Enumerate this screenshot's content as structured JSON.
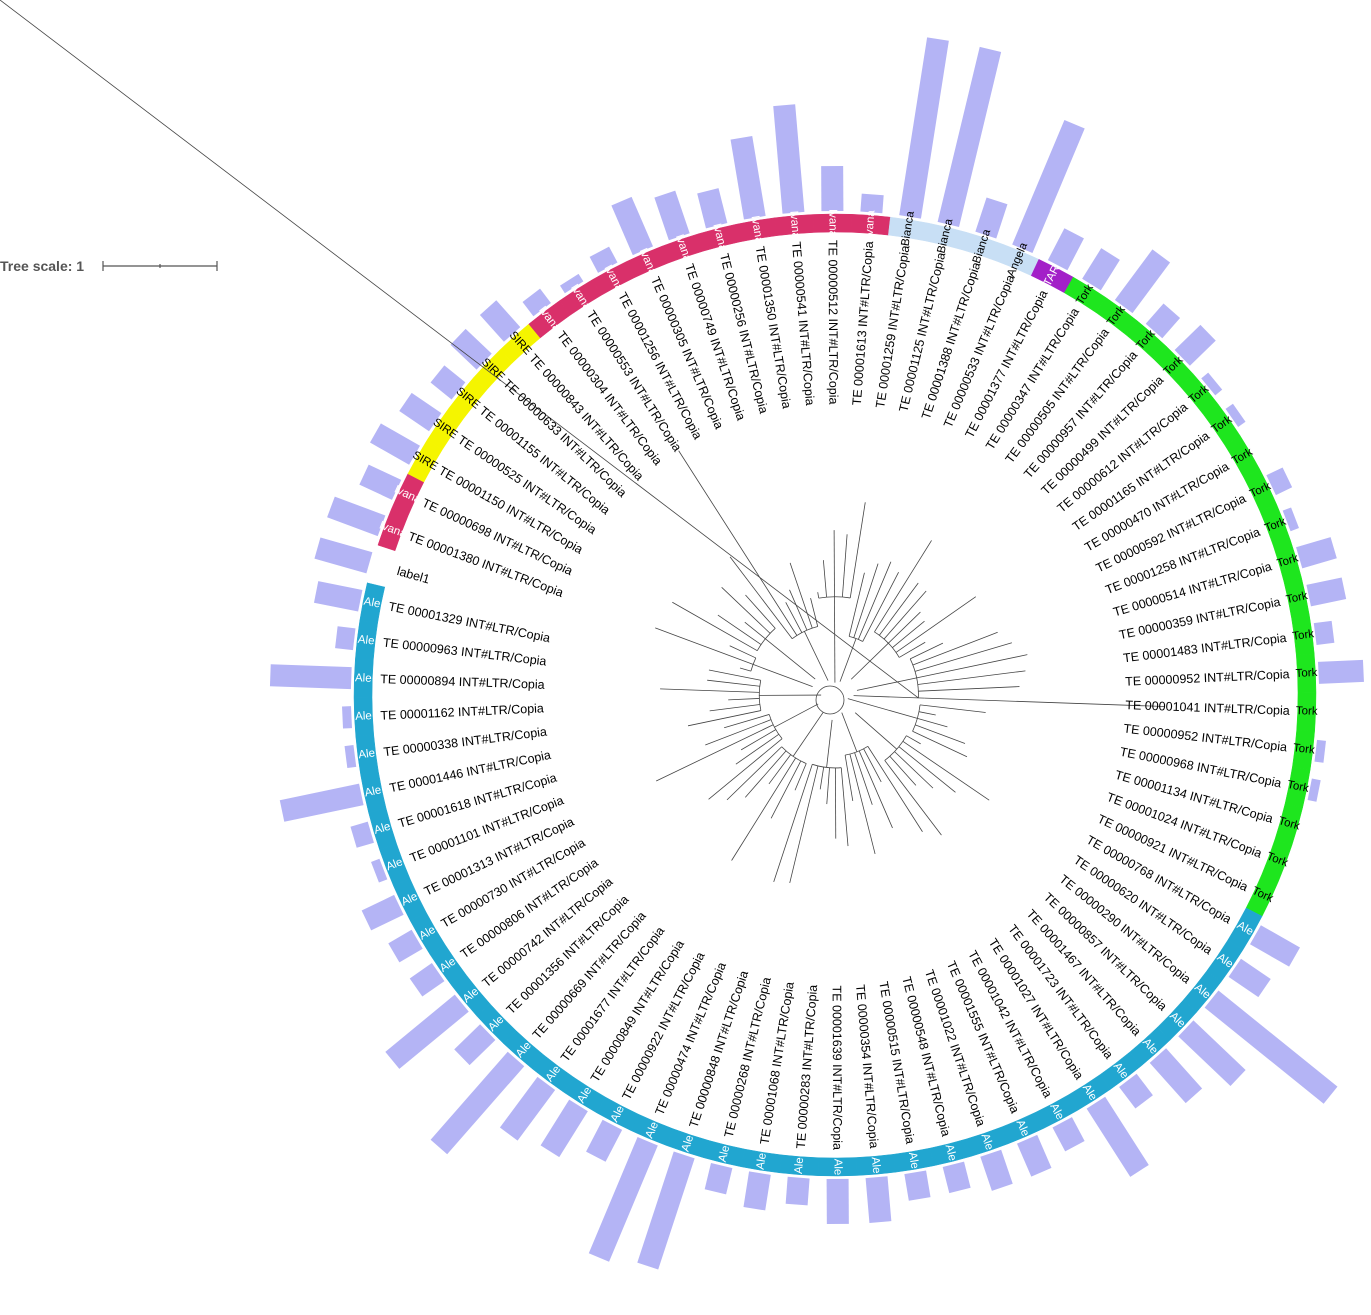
{
  "scale": {
    "label": "Tree scale: 1"
  },
  "colors": {
    "Ale": "#21a6d0",
    "Tork": "#1ee61e",
    "TAR": "#a320c8",
    "Angela": "#c8dff5",
    "Bianca": "#c8dff5",
    "Ivana": "#d9306a",
    "SIRE": "#f5f500",
    "label1": "#ffffff",
    "bars": "#b4b4f5"
  },
  "leaves": [
    {
      "label": "TE 00001041 INT#LTR/Copia",
      "clade": "Tork",
      "bar": 0.0
    },
    {
      "label": "TE 00000952 INT#LTR/Copia",
      "clade": "Tork",
      "bar": 0.1
    },
    {
      "label": "TE 00000968 INT#LTR/Copia",
      "clade": "Tork",
      "bar": 0.1
    },
    {
      "label": "TE 00001134 INT#LTR/Copia",
      "clade": "Tork",
      "bar": 0.0
    },
    {
      "label": "TE 00001024 INT#LTR/Copia",
      "clade": "Tork",
      "bar": 0.0
    },
    {
      "label": "TE 00000921 INT#LTR/Copia",
      "clade": "Tork",
      "bar": 0.0
    },
    {
      "label": "TE 00000768 INT#LTR/Copia",
      "clade": "Ale",
      "bar": 0.5
    },
    {
      "label": "TE 00000620 INT#LTR/Copia",
      "clade": "Ale",
      "bar": 0.4
    },
    {
      "label": "TE 00000290 INT#LTR/Copia",
      "clade": "Ale",
      "bar": 1.7
    },
    {
      "label": "TE 00000857 INT#LTR/Copia",
      "clade": "Ale",
      "bar": 0.8
    },
    {
      "label": "TE 00001467 INT#LTR/Copia",
      "clade": "Ale",
      "bar": 0.6
    },
    {
      "label": "TE 00001723 INT#LTR/Copia",
      "clade": "Ale",
      "bar": 0.3
    },
    {
      "label": "TE 00001027 INT#LTR/Copia",
      "clade": "Ale",
      "bar": 0.9
    },
    {
      "label": "TE 00001042 INT#LTR/Copia",
      "clade": "Ale",
      "bar": 0.3
    },
    {
      "label": "TE 00001555 INT#LTR/Copia",
      "clade": "Ale",
      "bar": 0.4
    },
    {
      "label": "TE 00001022 INT#LTR/Copia",
      "clade": "Ale",
      "bar": 0.4
    },
    {
      "label": "TE 00000548 INT#LTR/Copia",
      "clade": "Ale",
      "bar": 0.3
    },
    {
      "label": "TE 00000515 INT#LTR/Copia",
      "clade": "Ale",
      "bar": 0.3
    },
    {
      "label": "TE 00000354 INT#LTR/Copia",
      "clade": "Ale",
      "bar": 0.5
    },
    {
      "label": "TE 00001639 INT#LTR/Copia",
      "clade": "Ale",
      "bar": 0.5
    },
    {
      "label": "TE 00000283 INT#LTR/Copia",
      "clade": "Ale",
      "bar": 0.3
    },
    {
      "label": "TE 00001068 INT#LTR/Copia",
      "clade": "Ale",
      "bar": 0.4
    },
    {
      "label": "TE 00000268 INT#LTR/Copia",
      "clade": "Ale",
      "bar": 0.3
    },
    {
      "label": "TE 00000848 INT#LTR/Copia",
      "clade": "Ale",
      "bar": 1.3
    },
    {
      "label": "TE 00000474 INT#LTR/Copia",
      "clade": "Ale",
      "bar": 1.4
    },
    {
      "label": "TE 00000922 INT#LTR/Copia",
      "clade": "Ale",
      "bar": 0.4
    },
    {
      "label": "TE 00000849 INT#LTR/Copia",
      "clade": "Ale",
      "bar": 0.6
    },
    {
      "label": "TE 00001677 INT#LTR/Copia",
      "clade": "Ale",
      "bar": 0.7
    },
    {
      "label": "TE 00000669 INT#LTR/Copia",
      "clade": "Ale",
      "bar": 1.3
    },
    {
      "label": "TE 00001356 INT#LTR/Copia",
      "clade": "Ale",
      "bar": 0.4
    },
    {
      "label": "TE 00000742 INT#LTR/Copia",
      "clade": "Ale",
      "bar": 1.0
    },
    {
      "label": "TE 00000806 INT#LTR/Copia",
      "clade": "Ale",
      "bar": 0.3
    },
    {
      "label": "TE 00000730 INT#LTR/Copia",
      "clade": "Ale",
      "bar": 0.3
    },
    {
      "label": "TE 00001313 INT#LTR/Copia",
      "clade": "Ale",
      "bar": 0.4
    },
    {
      "label": "TE 00001101 INT#LTR/Copia",
      "clade": "Ale",
      "bar": 0.1
    },
    {
      "label": "TE 00001618 INT#LTR/Copia",
      "clade": "Ale",
      "bar": 0.2
    },
    {
      "label": "TE 00001446 INT#LTR/Copia",
      "clade": "Ale",
      "bar": 0.9
    },
    {
      "label": "TE 00000338 INT#LTR/Copia",
      "clade": "Ale",
      "bar": 0.1
    },
    {
      "label": "TE 00001162 INT#LTR/Copia",
      "clade": "Ale",
      "bar": 0.1
    },
    {
      "label": "TE 00000894 INT#LTR/Copia",
      "clade": "Ale",
      "bar": 0.9
    },
    {
      "label": "TE 00000963 INT#LTR/Copia",
      "clade": "Ale",
      "bar": 0.2
    },
    {
      "label": "TE 00001329 INT#LTR/Copia",
      "clade": "Ale",
      "bar": 0.5
    },
    {
      "label": "label1",
      "clade": "label1",
      "bar": 0.6
    },
    {
      "label": "TE 00001380 INT#LTR/Copia",
      "clade": "Ivana",
      "bar": 0.6
    },
    {
      "label": "TE 00000698 INT#LTR/Copia",
      "clade": "Ivana",
      "bar": 0.4
    },
    {
      "label": "TE 00001150 INT#LTR/Copia",
      "clade": "SIRE",
      "bar": 0.5
    },
    {
      "label": "TE 00000525 INT#LTR/Copia",
      "clade": "SIRE",
      "bar": 0.4
    },
    {
      "label": "TE 00001155 INT#LTR/Copia",
      "clade": "SIRE",
      "bar": 0.3
    },
    {
      "label": "TE 00000633 INT#LTR/Copia",
      "clade": "SIRE",
      "bar": 0.4
    },
    {
      "label": "TE 00000843 INT#LTR/Copia",
      "clade": "SIRE",
      "bar": 0.4
    },
    {
      "label": "TE 00000304 INT#LTR/Copia",
      "clade": "Ivana",
      "bar": 0.2
    },
    {
      "label": "TE 00000553 INT#LTR/Copia",
      "clade": "Ivana",
      "bar": 0.1
    },
    {
      "label": "TE 00001256 INT#LTR/Copia",
      "clade": "Ivana",
      "bar": 0.2
    },
    {
      "label": "TE 00000305 INT#LTR/Copia",
      "clade": "Ivana",
      "bar": 0.6
    },
    {
      "label": "TE 00000749 INT#LTR/Copia",
      "clade": "Ivana",
      "bar": 0.5
    },
    {
      "label": "TE 00000256 INT#LTR/Copia",
      "clade": "Ivana",
      "bar": 0.4
    },
    {
      "label": "TE 00001350 INT#LTR/Copia",
      "clade": "Ivana",
      "bar": 0.9
    },
    {
      "label": "TE 00000541 INT#LTR/Copia",
      "clade": "Ivana",
      "bar": 1.2
    },
    {
      "label": "TE 00000512 INT#LTR/Copia",
      "clade": "Ivana",
      "bar": 0.5
    },
    {
      "label": "TE 00001613 INT#LTR/Copia",
      "clade": "Ivana",
      "bar": 0.2
    },
    {
      "label": "TE 00001259 INT#LTR/Copia",
      "clade": "Bianca",
      "bar": 2.0
    },
    {
      "label": "TE 00001125 INT#LTR/Copia",
      "clade": "Bianca",
      "bar": 2.0
    },
    {
      "label": "TE 00001388 INT#LTR/Copia",
      "clade": "Bianca",
      "bar": 0.4
    },
    {
      "label": "TE 00000533 INT#LTR/Copia",
      "clade": "Angela",
      "bar": 1.5
    },
    {
      "label": "TE 00001377 INT#LTR/Copia",
      "clade": "TAR",
      "bar": 0.4
    },
    {
      "label": "TE 00000347 INT#LTR/Copia",
      "clade": "Tork",
      "bar": 0.4
    },
    {
      "label": "TE 00000505 INT#LTR/Copia",
      "clade": "Tork",
      "bar": 0.7
    },
    {
      "label": "TE 00000957 INT#LTR/Copia",
      "clade": "Tork",
      "bar": 0.3
    },
    {
      "label": "TE 00000499 INT#LTR/Copia",
      "clade": "Tork",
      "bar": 0.4
    },
    {
      "label": "TE 00000612 INT#LTR/Copia",
      "clade": "Tork",
      "bar": 0.1
    },
    {
      "label": "TE 00001165 INT#LTR/Copia",
      "clade": "Tork",
      "bar": 0.1
    },
    {
      "label": "TE 00000470 INT#LTR/Copia",
      "clade": "Tork",
      "bar": 0.0
    },
    {
      "label": "TE 00000592 INT#LTR/Copia",
      "clade": "Tork",
      "bar": 0.2
    },
    {
      "label": "TE 00001258 INT#LTR/Copia",
      "clade": "Tork",
      "bar": 0.1
    },
    {
      "label": "TE 00000514 INT#LTR/Copia",
      "clade": "Tork",
      "bar": 0.4
    },
    {
      "label": "TE 00000359 INT#LTR/Copia",
      "clade": "Tork",
      "bar": 0.4
    },
    {
      "label": "TE 00001483 INT#LTR/Copia",
      "clade": "Tork",
      "bar": 0.2
    },
    {
      "label": "TE 00000952 INT#LTR/Copia",
      "clade": "Tork",
      "bar": 0.5
    }
  ],
  "ring_labels": [
    {
      "text": "Tork",
      "clade": "Tork"
    },
    {
      "text": "Tork",
      "clade": "Tork"
    },
    {
      "text": "Tork",
      "clade": "Tork"
    },
    {
      "text": "Tork",
      "clade": "Tork"
    },
    {
      "text": "Tork",
      "clade": "Tork"
    },
    {
      "text": "Tork",
      "clade": "Tork"
    },
    {
      "text": "Ale",
      "clade": "Ale"
    },
    {
      "text": "Ale",
      "clade": "Ale"
    },
    {
      "text": "Ale",
      "clade": "Ale"
    },
    {
      "text": "Ale",
      "clade": "Ale"
    },
    {
      "text": "Ale",
      "clade": "Ale"
    },
    {
      "text": "Ale",
      "clade": "Ale"
    },
    {
      "text": "Ale",
      "clade": "Ale"
    },
    {
      "text": "Ale",
      "clade": "Ale"
    },
    {
      "text": "Ale",
      "clade": "Ale"
    },
    {
      "text": "Ale",
      "clade": "Ale"
    },
    {
      "text": "Ale",
      "clade": "Ale"
    },
    {
      "text": "Ale",
      "clade": "Ale"
    },
    {
      "text": "Ale",
      "clade": "Ale"
    },
    {
      "text": "Ale",
      "clade": "Ale"
    },
    {
      "text": "Ale",
      "clade": "Ale"
    },
    {
      "text": "Ale",
      "clade": "Ale"
    },
    {
      "text": "Ale",
      "clade": "Ale"
    },
    {
      "text": "Ale",
      "clade": "Ale"
    },
    {
      "text": "Ale",
      "clade": "Ale"
    },
    {
      "text": "Ale",
      "clade": "Ale"
    },
    {
      "text": "Ale",
      "clade": "Ale"
    },
    {
      "text": "Ale",
      "clade": "Ale"
    },
    {
      "text": "Ale",
      "clade": "Ale"
    },
    {
      "text": "Ale",
      "clade": "Ale"
    },
    {
      "text": "Ale",
      "clade": "Ale"
    },
    {
      "text": "Ale",
      "clade": "Ale"
    },
    {
      "text": "Ale",
      "clade": "Ale"
    },
    {
      "text": "Ale",
      "clade": "Ale"
    },
    {
      "text": "Ale",
      "clade": "Ale"
    },
    {
      "text": "Ale",
      "clade": "Ale"
    },
    {
      "text": "Ale",
      "clade": "Ale"
    },
    {
      "text": "Ale",
      "clade": "Ale"
    },
    {
      "text": "Ale",
      "clade": "Ale"
    },
    {
      "text": "Ale",
      "clade": "Ale"
    },
    {
      "text": "Ale",
      "clade": "Ale"
    },
    {
      "text": "Ale",
      "clade": "Ale"
    },
    {
      "text": "",
      "clade": "label1"
    },
    {
      "text": "Ivana",
      "clade": "Ivana"
    },
    {
      "text": "Ivana",
      "clade": "Ivana"
    },
    {
      "text": "SIRE",
      "clade": "SIRE"
    },
    {
      "text": "SIRE",
      "clade": "SIRE"
    },
    {
      "text": "SIRE",
      "clade": "SIRE"
    },
    {
      "text": "SIRE",
      "clade": "SIRE"
    },
    {
      "text": "SIRE",
      "clade": "SIRE"
    },
    {
      "text": "Ivana",
      "clade": "Ivana"
    },
    {
      "text": "Ivana",
      "clade": "Ivana"
    },
    {
      "text": "Ivana",
      "clade": "Ivana"
    },
    {
      "text": "Ivana",
      "clade": "Ivana"
    },
    {
      "text": "Ivana",
      "clade": "Ivana"
    },
    {
      "text": "Ivana",
      "clade": "Ivana"
    },
    {
      "text": "Ivana",
      "clade": "Ivana"
    },
    {
      "text": "Ivana",
      "clade": "Ivana"
    },
    {
      "text": "Ivana",
      "clade": "Ivana"
    },
    {
      "text": "Ivana",
      "clade": "Ivana"
    },
    {
      "text": "Bianca",
      "clade": "Bianca"
    },
    {
      "text": "Bianca",
      "clade": "Bianca"
    },
    {
      "text": "Bianca",
      "clade": "Bianca"
    },
    {
      "text": "Angela",
      "clade": "Angela"
    },
    {
      "text": "TAR",
      "clade": "TAR"
    },
    {
      "text": "Tork",
      "clade": "Tork"
    },
    {
      "text": "Tork",
      "clade": "Tork"
    },
    {
      "text": "Tork",
      "clade": "Tork"
    },
    {
      "text": "Tork",
      "clade": "Tork"
    },
    {
      "text": "Tork",
      "clade": "Tork"
    },
    {
      "text": "Tork",
      "clade": "Tork"
    },
    {
      "text": "Tork",
      "clade": "Tork"
    },
    {
      "text": "Tork",
      "clade": "Tork"
    },
    {
      "text": "Tork",
      "clade": "Tork"
    },
    {
      "text": "Tork",
      "clade": "Tork"
    },
    {
      "text": "Tork",
      "clade": "Tork"
    },
    {
      "text": "Tork",
      "clade": "Tork"
    },
    {
      "text": "Tork",
      "clade": "Tork"
    }
  ]
}
